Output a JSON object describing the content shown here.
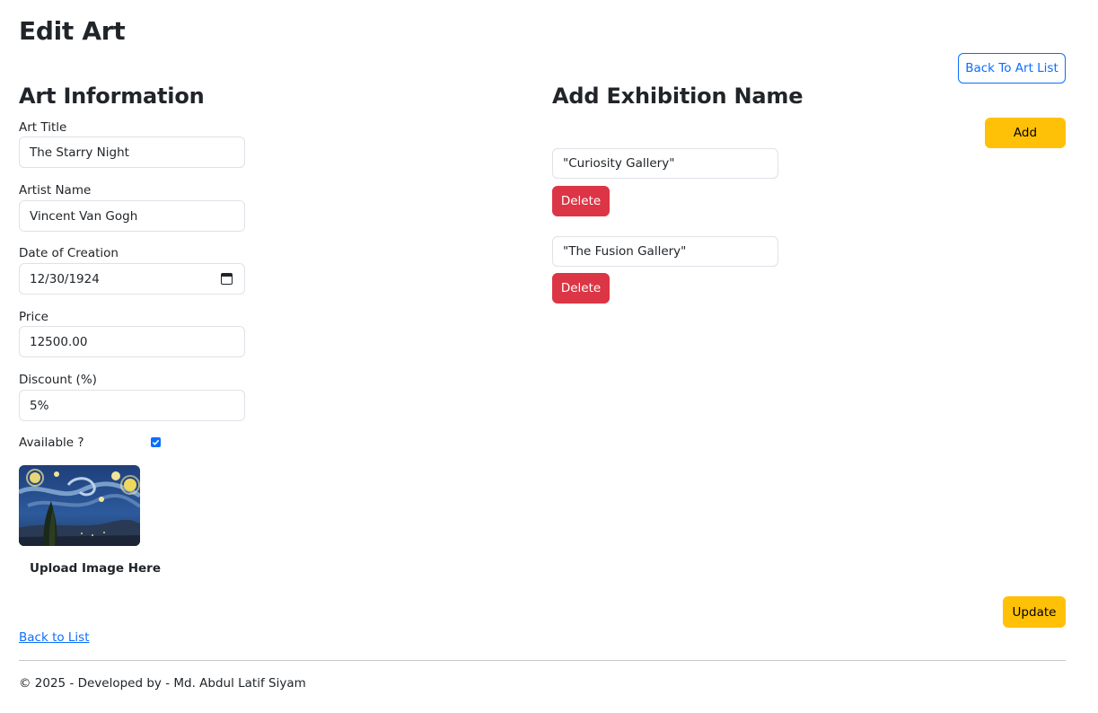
{
  "page_title": "Edit Art",
  "back_to_art_list": "Back To Art List",
  "art_info": {
    "heading": "Art Information",
    "fields": [
      {
        "label": "Art Title",
        "value": "The Starry Night"
      },
      {
        "label": "Artist Name",
        "value": "Vincent Van Gogh"
      },
      {
        "label": "Date of Creation",
        "value": "12/30/1924"
      },
      {
        "label": "Price",
        "value": "12500.00"
      },
      {
        "label": "Discount (%)",
        "value": "5%"
      }
    ],
    "available_label": "Available ?",
    "available_checked": true,
    "upload_label": "Upload Image Here"
  },
  "exhibition": {
    "heading": "Add Exhibition Name",
    "add_label": "Add",
    "items": [
      {
        "value": "\"Curiosity Gallery\"",
        "delete_label": "Delete"
      },
      {
        "value": "\"The Fusion Gallery\"",
        "delete_label": "Delete"
      }
    ]
  },
  "update_label": "Update",
  "back_to_list": "Back to List",
  "footer": "© 2025 - Developed by - Md. Abdul Latif Siyam",
  "colors": {
    "primary": "#0d6efd",
    "warning": "#ffc107",
    "danger": "#dc3545"
  }
}
